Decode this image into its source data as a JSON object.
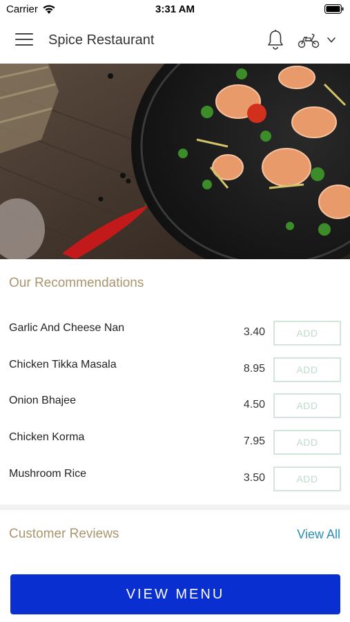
{
  "status_bar": {
    "carrier": "Carrier",
    "time": "3:31 AM"
  },
  "app_bar": {
    "title": "Spice Restaurant",
    "icons": [
      "hamburger-menu-icon",
      "bell-icon",
      "scooter-icon",
      "chevron-down-icon"
    ]
  },
  "recommendations": {
    "title": "Our Recommendations",
    "items": [
      {
        "name": "Garlic And Cheese Nan",
        "price": "3.40",
        "button": "ADD"
      },
      {
        "name": "Chicken Tikka Masala",
        "price": "8.95",
        "button": "ADD"
      },
      {
        "name": "Onion Bhajee",
        "price": "4.50",
        "button": "ADD"
      },
      {
        "name": "Chicken Korma",
        "price": "7.95",
        "button": "ADD"
      },
      {
        "name": "Mushroom Rice",
        "price": "3.50",
        "button": "ADD"
      }
    ]
  },
  "reviews": {
    "title": "Customer Reviews",
    "view_all": "View All"
  },
  "footer": {
    "view_menu": "VIEW MENU"
  },
  "colors": {
    "accent_gold": "#a8976e",
    "link_blue": "#2a8fb4",
    "primary_button": "#0a2fd1",
    "add_border": "#cfe6d8"
  }
}
